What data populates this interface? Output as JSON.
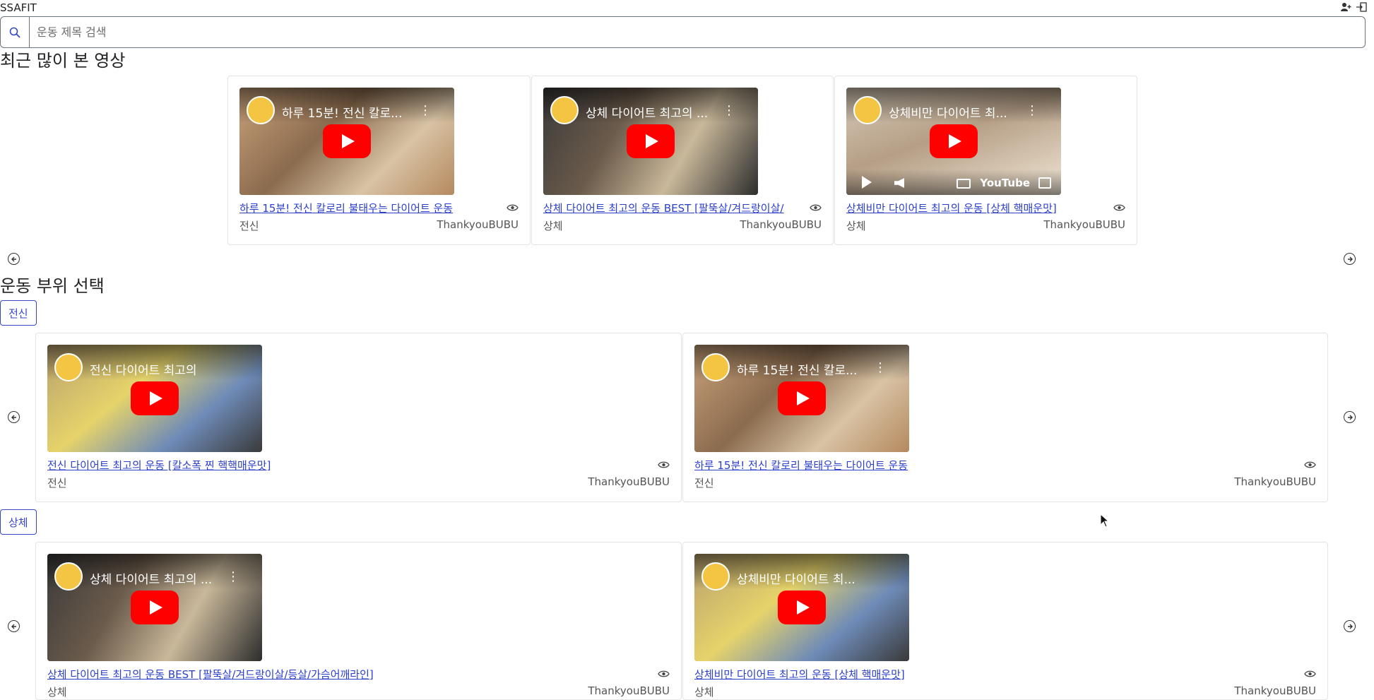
{
  "app": {
    "brand": "SSAFIT"
  },
  "search": {
    "placeholder": "운동 제목 검색"
  },
  "recent": {
    "title": "최근 많이 본 영상",
    "videos": [
      {
        "thumb_title": "하루 15분! 전신 칼로...",
        "link": "하루 15분! 전신 칼로리 불태우는 다이어트 운동",
        "part": "전신",
        "channel": "ThankyouBUBU"
      },
      {
        "thumb_title": "상체 다이어트 최고의 ...",
        "link": "상체 다이어트 최고의 운동 BEST [팔뚝살/겨드랑이살/",
        "part": "상체",
        "channel": "ThankyouBUBU"
      },
      {
        "thumb_title": "상체비만 다이어트 최...",
        "link": "상체비만 다이어트 최고의 운동 [상체 핵매운맛]",
        "part": "상체",
        "channel": "ThankyouBUBU",
        "youtube_label": "YouTube"
      }
    ]
  },
  "parts": {
    "title": "운동 부위 선택",
    "groups": [
      {
        "label": "전신",
        "videos": [
          {
            "thumb_title": "전신 다이어트 최고의",
            "link": "전신 다이어트 최고의 운동 [칼소폭 찐 핵핵매운맛]",
            "part": "전신",
            "channel": "ThankyouBUBU"
          },
          {
            "thumb_title": "하루 15분! 전신 칼로...",
            "link": "하루 15분! 전신 칼로리 불태우는 다이어트 운동",
            "part": "전신",
            "channel": "ThankyouBUBU"
          }
        ]
      },
      {
        "label": "상체",
        "videos": [
          {
            "thumb_title": "상체 다이어트 최고의 ...",
            "link": "상체 다이어트 최고의 운동 BEST [팔뚝살/겨드랑이살/등살/가슴어깨라인]",
            "part": "상체",
            "channel": "ThankyouBUBU"
          },
          {
            "thumb_title": "상체비만 다이어트 최...",
            "link": "상체비만 다이어트 최고의 운동 [상체 핵매운맛]",
            "part": "상체",
            "channel": "ThankyouBUBU"
          }
        ]
      }
    ]
  },
  "colors": {
    "link": "#2a3fc9",
    "accent": "#3546c8",
    "play": "#ff0000"
  },
  "icons": [
    "search-icon",
    "user-add-icon",
    "logout-icon",
    "eye-icon",
    "arrow-left-circle-icon",
    "arrow-right-circle-icon",
    "play-icon"
  ]
}
